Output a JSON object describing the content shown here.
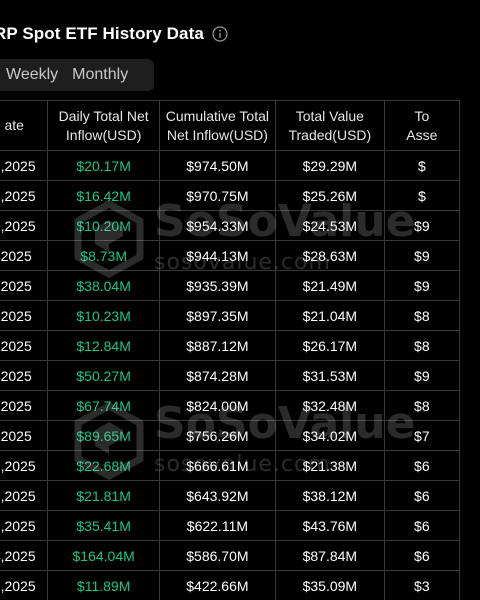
{
  "header": {
    "title": "RP Spot ETF History Data"
  },
  "tabs": [
    {
      "label": "Weekly"
    },
    {
      "label": "Monthly"
    }
  ],
  "watermark": {
    "brand": "SoSoValue",
    "url": "sosovalue.com"
  },
  "colors": {
    "positive": "#16c784",
    "background": "#000000",
    "border": "#383838",
    "tab_bg": "#1e1e1e"
  },
  "table": {
    "columns": [
      {
        "line1": "ate",
        "line2": ""
      },
      {
        "line1": "Daily Total Net",
        "line2": "Inflow(USD)"
      },
      {
        "line1": "Cumulative Total",
        "line2": "Net Inflow(USD)"
      },
      {
        "line1": "Total Value",
        "line2": "Traded(USD)"
      },
      {
        "line1": "To",
        "line2": "Asse"
      }
    ],
    "rows": [
      {
        "date": "2,2025",
        "daily": "$20.17M",
        "cumulative": "$974.50M",
        "traded": "$29.29M",
        "assets": "$"
      },
      {
        "date": "1,2025",
        "daily": "$16.42M",
        "cumulative": "$970.75M",
        "traded": "$25.26M",
        "assets": "$"
      },
      {
        "date": "0,2025",
        "daily": "$10.20M",
        "cumulative": "$954.33M",
        "traded": "$24.53M",
        "assets": "$9"
      },
      {
        "date": ",2025",
        "daily": "$8.73M",
        "cumulative": "$944.13M",
        "traded": "$28.63M",
        "assets": "$9"
      },
      {
        "date": ",2025",
        "daily": "$38.04M",
        "cumulative": "$935.39M",
        "traded": "$21.49M",
        "assets": "$9"
      },
      {
        "date": ",2025",
        "daily": "$10.23M",
        "cumulative": "$897.35M",
        "traded": "$21.04M",
        "assets": "$8"
      },
      {
        "date": ",2025",
        "daily": "$12.84M",
        "cumulative": "$887.12M",
        "traded": "$26.17M",
        "assets": "$8"
      },
      {
        "date": ",2025",
        "daily": "$50.27M",
        "cumulative": "$874.28M",
        "traded": "$31.53M",
        "assets": "$9"
      },
      {
        "date": ",2025",
        "daily": "$67.74M",
        "cumulative": "$824.00M",
        "traded": "$32.48M",
        "assets": "$8"
      },
      {
        "date": ",2025",
        "daily": "$89.65M",
        "cumulative": "$756.26M",
        "traded": "$34.02M",
        "assets": "$7"
      },
      {
        "date": "8,2025",
        "daily": "$22.68M",
        "cumulative": "$666.61M",
        "traded": "$21.38M",
        "assets": "$6"
      },
      {
        "date": "6,2025",
        "daily": "$21.81M",
        "cumulative": "$643.92M",
        "traded": "$38.12M",
        "assets": "$6"
      },
      {
        "date": "5,2025",
        "daily": "$35.41M",
        "cumulative": "$622.11M",
        "traded": "$43.76M",
        "assets": "$6"
      },
      {
        "date": "4,2025",
        "daily": "$164.04M",
        "cumulative": "$586.70M",
        "traded": "$87.84M",
        "assets": "$6"
      },
      {
        "date": "1,2025",
        "daily": "$11.89M",
        "cumulative": "$422.66M",
        "traded": "$35.09M",
        "assets": "$3"
      }
    ]
  }
}
